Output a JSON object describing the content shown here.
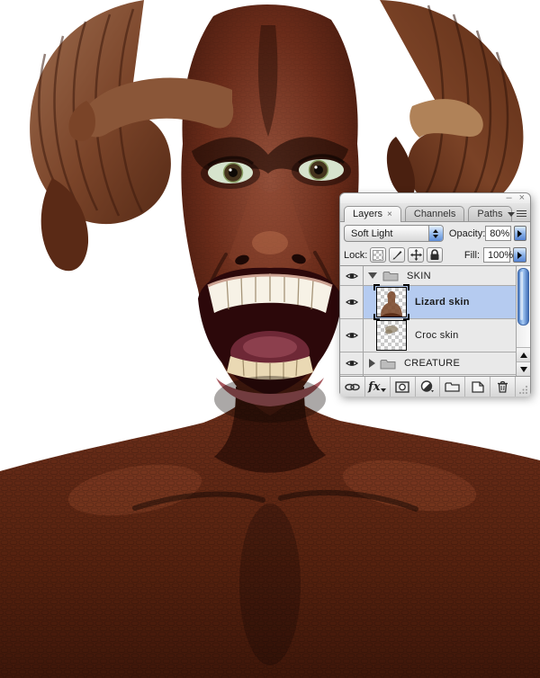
{
  "titlebar": {
    "minimize": "–",
    "close": "×"
  },
  "tabs": [
    {
      "label": "Layers",
      "close_glyph": "×",
      "active": true
    },
    {
      "label": "Channels",
      "active": false
    },
    {
      "label": "Paths",
      "active": false
    }
  ],
  "controls": {
    "blend_mode_value": "Soft Light",
    "opacity_label": "Opacity:",
    "opacity_value": "80%",
    "lock_label": "Lock:",
    "fill_label": "Fill:",
    "fill_value": "100%"
  },
  "layers": [
    {
      "kind": "group",
      "name": "SKIN",
      "visible": true,
      "expanded": true,
      "selected": false
    },
    {
      "kind": "layer",
      "name": "Lizard skin",
      "visible": true,
      "selected": true
    },
    {
      "kind": "layer",
      "name": "Croc skin",
      "visible": true,
      "selected": false
    },
    {
      "kind": "group",
      "name": "CREATURE",
      "visible": true,
      "expanded": false,
      "selected": false
    }
  ],
  "toolbar": {
    "fx_label": "fx",
    "icons": [
      "link-layers",
      "layer-styles",
      "add-layer-mask",
      "new-adjustment-layer",
      "new-group",
      "new-layer",
      "delete-layer"
    ]
  },
  "colors": {
    "selection_blue": "#b5cbf0",
    "panel_bg": "#e9e9e9",
    "aqua_accent": "#5e8ed8",
    "skin_dark": "#4a1d10",
    "skin_mid": "#7c3a24"
  }
}
